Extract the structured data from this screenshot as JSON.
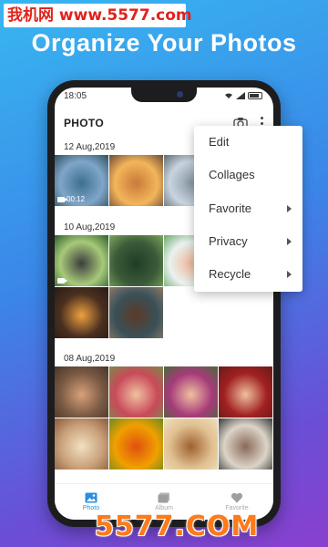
{
  "watermark_top": "我机网 www.5577.com",
  "headline": "Organize Your Photos",
  "status_bar": {
    "time": "18:05"
  },
  "app_bar": {
    "title": "PHOTO"
  },
  "sections": [
    {
      "date": "12 Aug,2019",
      "thumbs": [
        {
          "colors": [
            "#7fa6c8",
            "#3e6f8f",
            "#2f4f5f"
          ],
          "video": true,
          "duration": "00:12"
        },
        {
          "colors": [
            "#f3b55a",
            "#c97a3a",
            "#6d4a36"
          ],
          "video": false
        },
        {
          "colors": [
            "#c9d4de",
            "#8a9aa8",
            "#5c6a72"
          ],
          "video": false
        }
      ]
    },
    {
      "date": "10 Aug,2019",
      "thumbs": [
        {
          "colors": [
            "#a7c97a",
            "#3d3d3d",
            "#2c5f2a"
          ],
          "video": true,
          "duration": ""
        },
        {
          "colors": [
            "#3c5b3a",
            "#1f3d24",
            "#7aa85a"
          ],
          "video": false
        },
        {
          "colors": [
            "#e9f2f0",
            "#f0b99c",
            "#6aa56a"
          ],
          "video": false
        },
        {
          "colors": [
            "#f6d8b8",
            "#e79a5a",
            "#7aa86a"
          ],
          "video": false
        },
        {
          "colors": [
            "#4a3020",
            "#f0a040",
            "#2a1a14"
          ],
          "video": false
        },
        {
          "colors": [
            "#3a5058",
            "#5c3a26",
            "#8c7a6a"
          ],
          "video": false
        }
      ]
    },
    {
      "date": "08 Aug,2019",
      "thumbs": [
        {
          "colors": [
            "#7a5a44",
            "#d9a07a",
            "#4a3428"
          ],
          "video": false
        },
        {
          "colors": [
            "#c94a5a",
            "#f0c0a0",
            "#7a8a4a"
          ],
          "video": false
        },
        {
          "colors": [
            "#a63a7a",
            "#f0c0a0",
            "#4a6a3a"
          ],
          "video": false
        },
        {
          "colors": [
            "#a02020",
            "#f0c0a0",
            "#6a1a1a"
          ],
          "video": false
        },
        {
          "colors": [
            "#c9a07a",
            "#f0e0c0",
            "#8a5a3a"
          ],
          "video": false
        },
        {
          "colors": [
            "#f0a000",
            "#e05010",
            "#6a8a20"
          ],
          "video": false
        },
        {
          "colors": [
            "#e0c090",
            "#a06030",
            "#f0e0c0"
          ],
          "video": false
        },
        {
          "colors": [
            "#dcd4c8",
            "#8a6a5a",
            "#3a3a3a"
          ],
          "video": false
        }
      ]
    }
  ],
  "menu": {
    "items": [
      {
        "label": "Edit",
        "submenu": false
      },
      {
        "label": "Collages",
        "submenu": false
      },
      {
        "label": "Favorite",
        "submenu": true
      },
      {
        "label": "Privacy",
        "submenu": true
      },
      {
        "label": "Recycle",
        "submenu": true
      }
    ]
  },
  "tabs": [
    {
      "label": "Photo",
      "icon": "photo-icon",
      "active": true
    },
    {
      "label": "Album",
      "icon": "album-icon",
      "active": false
    },
    {
      "label": "Favorite",
      "icon": "heart-icon",
      "active": false
    }
  ],
  "watermark_bottom": "5577.COM",
  "colors": {
    "accent": "#2a8fe0",
    "watermark_red": "#e0221c",
    "watermark_orange": "#ff7a1a"
  }
}
